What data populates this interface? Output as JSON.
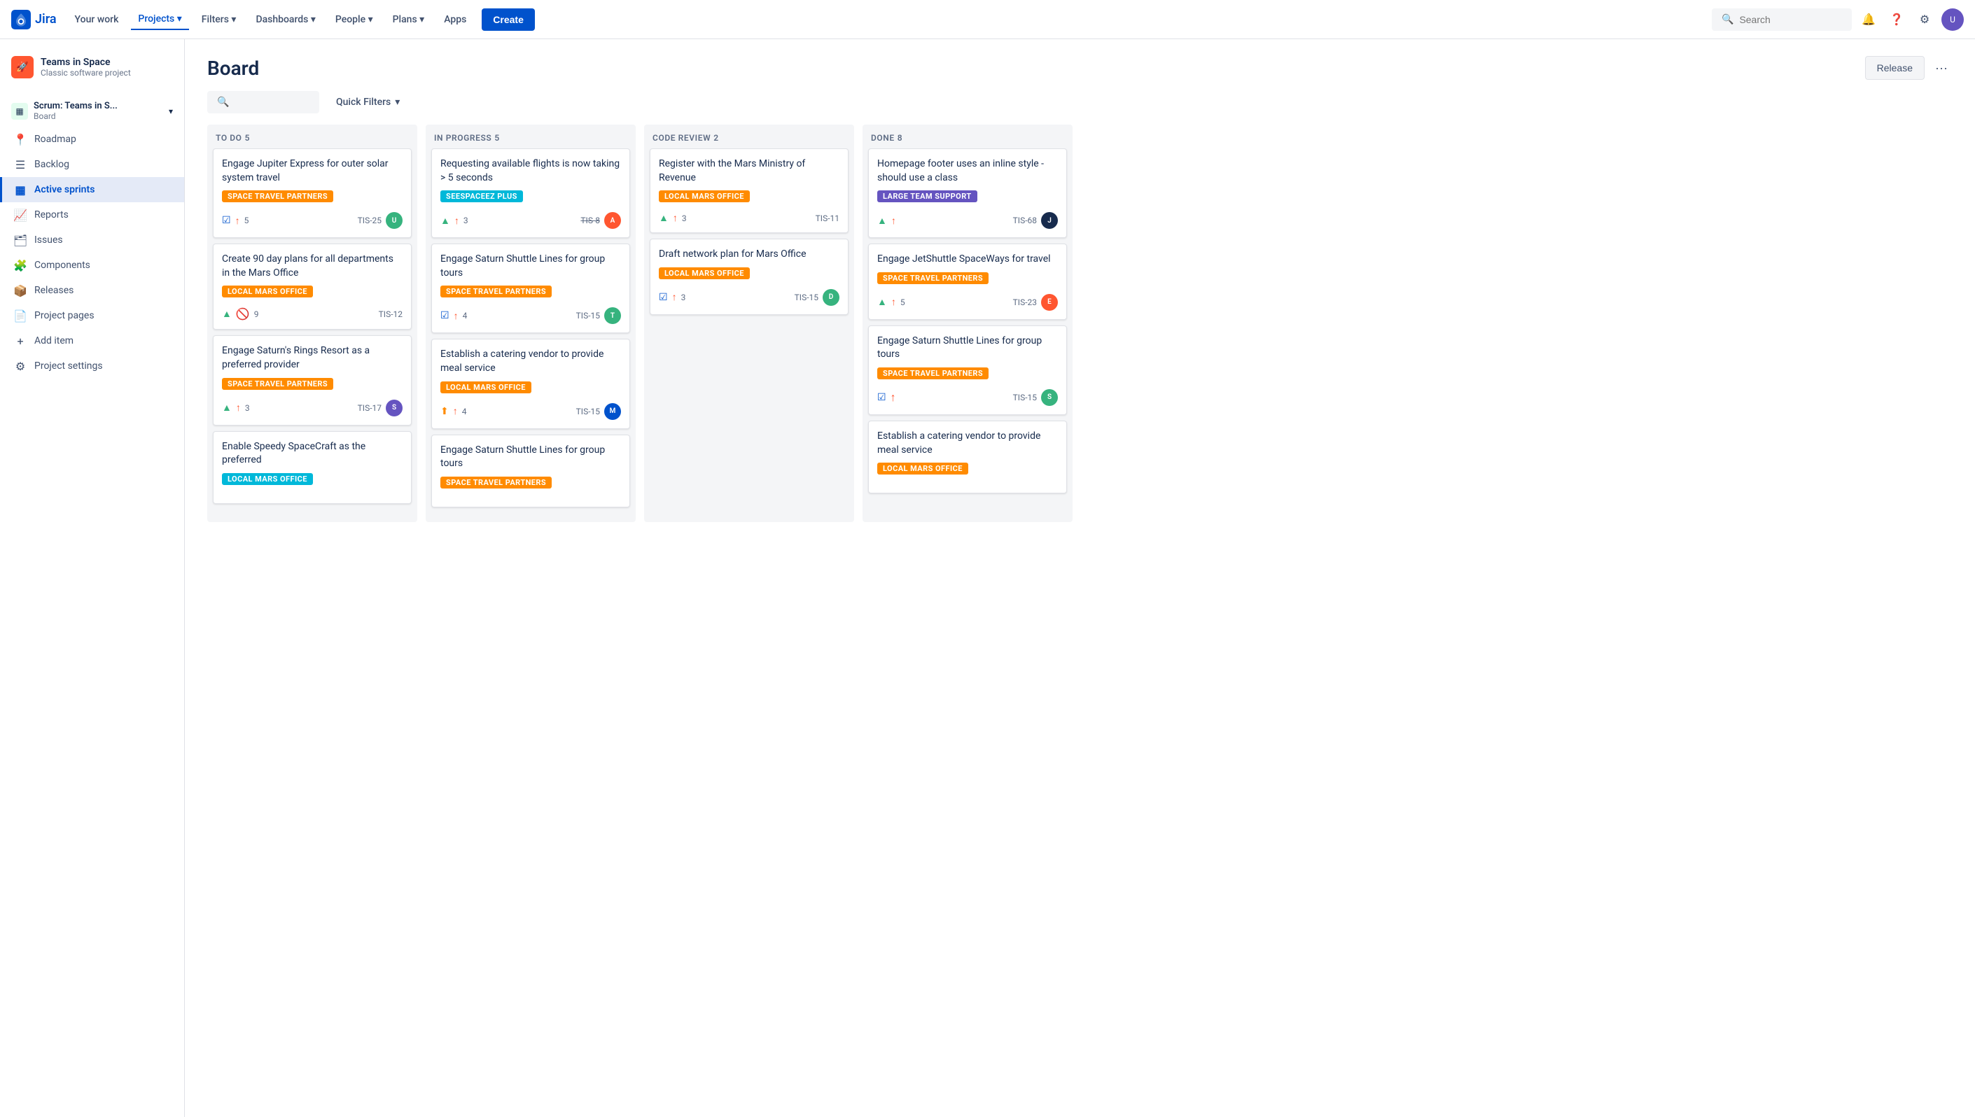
{
  "topnav": {
    "logo_text": "Jira",
    "links": [
      {
        "id": "your-work",
        "label": "Your work"
      },
      {
        "id": "projects",
        "label": "Projects",
        "active": true,
        "has_dropdown": true
      },
      {
        "id": "filters",
        "label": "Filters",
        "has_dropdown": true
      },
      {
        "id": "dashboards",
        "label": "Dashboards",
        "has_dropdown": true
      },
      {
        "id": "people",
        "label": "People",
        "has_dropdown": true
      },
      {
        "id": "plans",
        "label": "Plans",
        "has_dropdown": true
      },
      {
        "id": "apps",
        "label": "Apps",
        "has_dropdown": true
      }
    ],
    "create_label": "Create",
    "search_placeholder": "Search",
    "bell_icon": "🔔",
    "help_icon": "?",
    "gear_icon": "⚙"
  },
  "sidebar": {
    "project_name": "Teams in Space",
    "project_type": "Classic software project",
    "scrum_label": "Scrum: Teams in S...",
    "scrum_sub": "Board",
    "nav_items": [
      {
        "id": "roadmap",
        "label": "Roadmap",
        "icon": "📍"
      },
      {
        "id": "backlog",
        "label": "Backlog",
        "icon": "☰"
      },
      {
        "id": "active-sprints",
        "label": "Active sprints",
        "icon": "▦",
        "active": true
      },
      {
        "id": "reports",
        "label": "Reports",
        "icon": "📈"
      },
      {
        "id": "issues",
        "label": "Issues",
        "icon": "🗂"
      },
      {
        "id": "components",
        "label": "Components",
        "icon": "🧩"
      },
      {
        "id": "releases",
        "label": "Releases",
        "icon": "📦"
      },
      {
        "id": "project-pages",
        "label": "Project pages",
        "icon": "📄"
      },
      {
        "id": "add-item",
        "label": "Add item",
        "icon": "+"
      },
      {
        "id": "project-settings",
        "label": "Project settings",
        "icon": "⚙"
      }
    ]
  },
  "board": {
    "title": "Board",
    "release_label": "Release",
    "more_label": "···",
    "filter_placeholder": "",
    "quick_filters_label": "Quick Filters",
    "columns": [
      {
        "id": "todo",
        "header": "TO DO",
        "count": 5,
        "cards": [
          {
            "id": "card-1",
            "title": "Engage Jupiter Express for outer solar system travel",
            "label": "SPACE TRAVEL PARTNERS",
            "label_color": "orange",
            "icons": [
              "checkbox",
              "arrow-up"
            ],
            "count": "5",
            "ticket_id": "TIS-25",
            "has_avatar": true,
            "avatar_color": "#36b37e",
            "avatar_text": "U"
          },
          {
            "id": "card-2",
            "title": "Create 90 day plans for all departments in the Mars Office",
            "label": "LOCAL MARS OFFICE",
            "label_color": "orange",
            "icons": [
              "story",
              "block"
            ],
            "count": "9",
            "ticket_id": "TIS-12",
            "has_avatar": false
          },
          {
            "id": "card-3",
            "title": "Engage Saturn's Rings Resort as a preferred provider",
            "label": "SPACE TRAVEL PARTNERS",
            "label_color": "orange",
            "icons": [
              "story",
              "arrow-up"
            ],
            "count": "3",
            "ticket_id": "TIS-17",
            "has_avatar": true,
            "avatar_color": "#6554c0",
            "avatar_text": "S"
          },
          {
            "id": "card-4",
            "title": "Enable Speedy SpaceCraft as the preferred",
            "label": "LOCAL MARS OFFICE",
            "label_color": "teal",
            "icons": [],
            "count": "",
            "ticket_id": "",
            "has_avatar": false
          }
        ]
      },
      {
        "id": "inprogress",
        "header": "IN PROGRESS",
        "count": 5,
        "cards": [
          {
            "id": "card-5",
            "title": "Requesting available flights is now taking > 5 seconds",
            "label": "SEESPACEEZ PLUS",
            "label_color": "teal",
            "icons": [
              "story",
              "arrow-up"
            ],
            "count": "3",
            "ticket_id": "TIS-8",
            "strikethrough": true,
            "has_avatar": true,
            "avatar_color": "#ff5630",
            "avatar_text": "A"
          },
          {
            "id": "card-6",
            "title": "Engage Saturn Shuttle Lines for group tours",
            "label": "SPACE TRAVEL PARTNERS",
            "label_color": "orange",
            "icons": [
              "checkbox",
              "arrow-up"
            ],
            "count": "4",
            "ticket_id": "TIS-15",
            "has_avatar": true,
            "avatar_color": "#36b37e",
            "avatar_text": "T"
          },
          {
            "id": "card-7",
            "title": "Establish a catering vendor to provide meal service",
            "label": "LOCAL MARS OFFICE",
            "label_color": "orange",
            "icons": [
              "task",
              "arrow-up"
            ],
            "count": "4",
            "ticket_id": "TIS-15",
            "has_avatar": true,
            "avatar_color": "#0052cc",
            "avatar_text": "M"
          },
          {
            "id": "card-8",
            "title": "Engage Saturn Shuttle Lines for group tours",
            "label": "SPACE TRAVEL PARTNERS",
            "label_color": "orange",
            "icons": [],
            "count": "",
            "ticket_id": "",
            "has_avatar": false
          }
        ]
      },
      {
        "id": "codereview",
        "header": "CODE REVIEW",
        "count": 2,
        "cards": [
          {
            "id": "card-9",
            "title": "Register with the Mars Ministry of Revenue",
            "label": "LOCAL MARS OFFICE",
            "label_color": "orange",
            "icons": [
              "story",
              "arrow-up"
            ],
            "count": "3",
            "ticket_id": "TIS-11",
            "has_avatar": false
          },
          {
            "id": "card-10",
            "title": "Draft network plan for Mars Office",
            "label": "LOCAL MARS OFFICE",
            "label_color": "orange",
            "icons": [
              "checkbox",
              "arrow-up"
            ],
            "count": "3",
            "ticket_id": "TIS-15",
            "has_avatar": true,
            "avatar_color": "#36b37e",
            "avatar_text": "D"
          }
        ]
      },
      {
        "id": "done",
        "header": "DONE",
        "count": 8,
        "cards": [
          {
            "id": "card-11",
            "title": "Homepage footer uses an inline style - should use a class",
            "label": "LARGE TEAM SUPPORT",
            "label_color": "purple",
            "icons": [
              "story",
              "arrow-up"
            ],
            "count": "",
            "ticket_id": "TIS-68",
            "has_avatar": true,
            "avatar_color": "#172b4d",
            "avatar_text": "J"
          },
          {
            "id": "card-12",
            "title": "Engage JetShuttle SpaceWays for travel",
            "label": "SPACE TRAVEL PARTNERS",
            "label_color": "orange",
            "icons": [
              "story",
              "arrow-up"
            ],
            "count": "5",
            "ticket_id": "TIS-23",
            "has_avatar": true,
            "avatar_color": "#ff5630",
            "avatar_text": "E"
          },
          {
            "id": "card-13",
            "title": "Engage Saturn Shuttle Lines for group tours",
            "label": "SPACE TRAVEL PARTNERS",
            "label_color": "orange",
            "icons": [
              "checkbox",
              "up-arrow"
            ],
            "count": "",
            "ticket_id": "TIS-15",
            "has_avatar": true,
            "avatar_color": "#36b37e",
            "avatar_text": "S"
          },
          {
            "id": "card-14",
            "title": "Establish a catering vendor to provide meal service",
            "label": "LOCAL MARS OFFICE",
            "label_color": "orange",
            "icons": [],
            "count": "",
            "ticket_id": "",
            "has_avatar": false
          }
        ]
      }
    ]
  }
}
